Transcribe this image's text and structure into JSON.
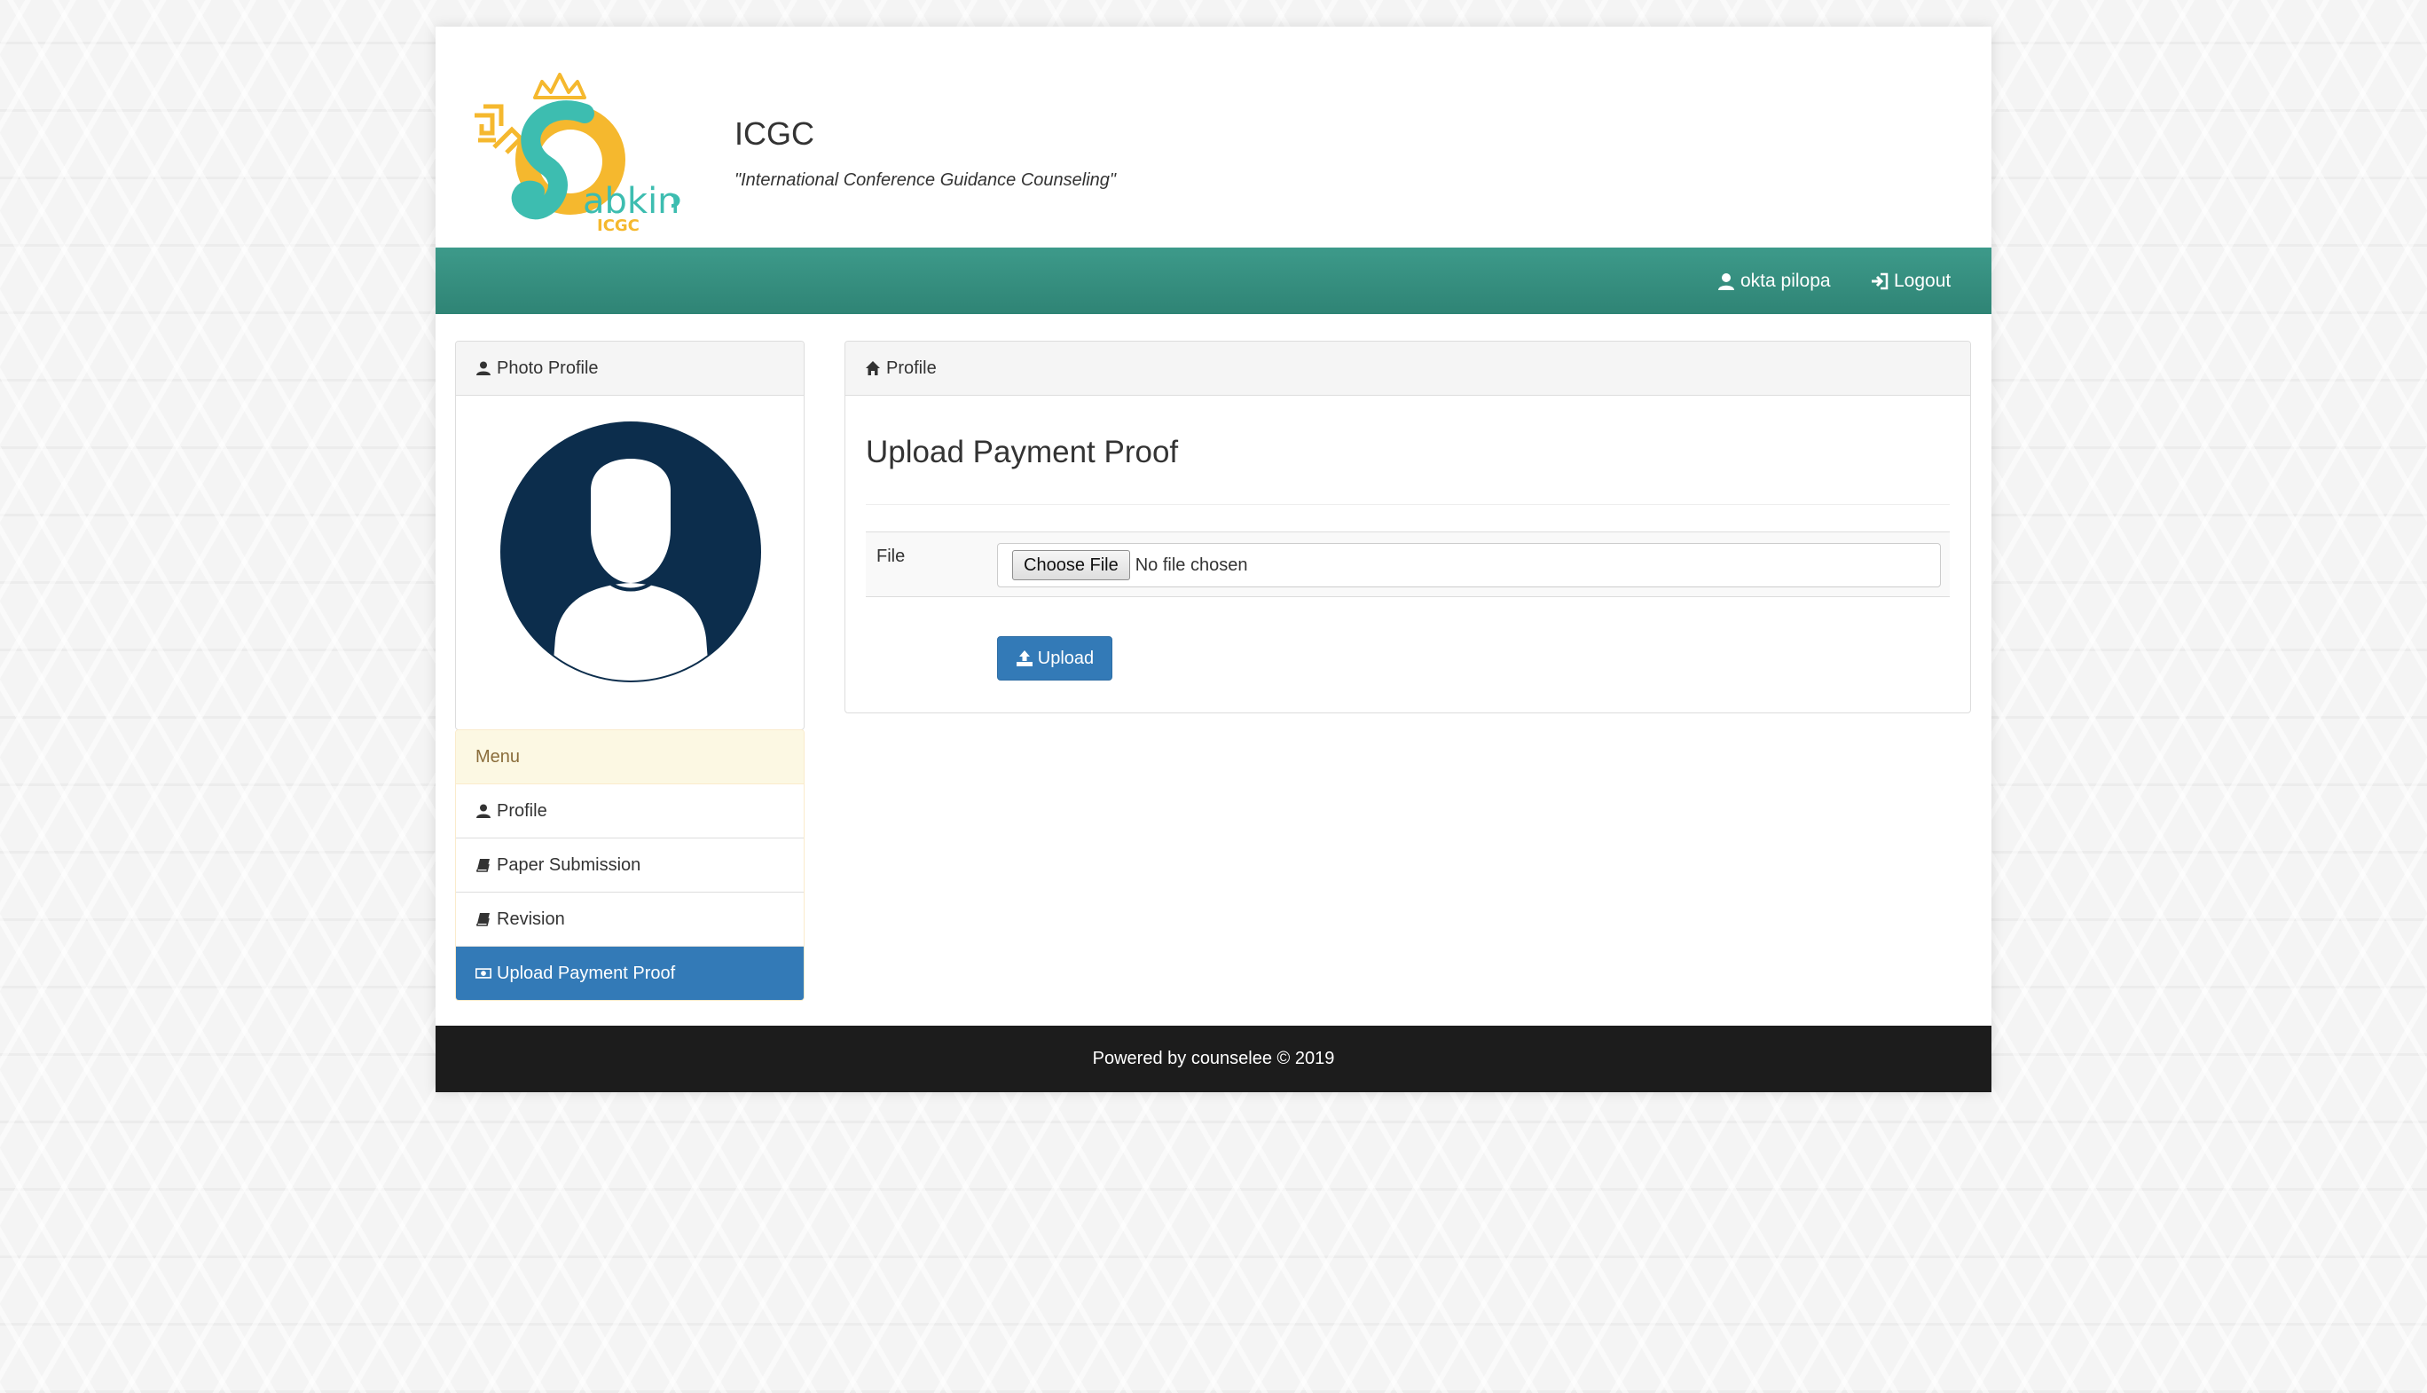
{
  "header": {
    "title": "ICGC",
    "tagline": "\"International Conference Guidance Counseling\"",
    "logo": {
      "icon": "sabkin-logo",
      "wordmark": "abkin",
      "subtext": "ICGC",
      "colors": {
        "yellow": "#f5b82e",
        "teal": "#3dbdb0"
      }
    }
  },
  "navbar": {
    "user_name": "okta pilopa",
    "logout_label": "Logout",
    "user_icon": "user-icon",
    "logout_icon": "sign-in-icon",
    "color": "#3a9484"
  },
  "photo_panel": {
    "title": "Photo Profile",
    "icon": "user-icon"
  },
  "menu": {
    "title": "Menu",
    "items": [
      {
        "label": "Profile",
        "icon": "user-icon"
      },
      {
        "label": "Paper Submission",
        "icon": "book-icon"
      },
      {
        "label": "Revision",
        "icon": "book-icon"
      },
      {
        "label": "Upload Payment Proof",
        "icon": "money-icon",
        "active": true
      }
    ]
  },
  "content": {
    "breadcrumb": "Profile",
    "breadcrumb_icon": "home-icon",
    "page_title": "Upload Payment Proof",
    "form": {
      "file_label": "File",
      "choose_file_label": "Choose File",
      "no_file_text": "No file chosen",
      "upload_label": "Upload",
      "upload_icon": "upload-icon"
    }
  },
  "footer": {
    "text": "Powered by counselee © 2019"
  },
  "colors": {
    "primary": "#337ab7",
    "nav_teal": "#3a9484",
    "avatar": "#0c2d4c",
    "warning_bg": "#fcf8e3",
    "footer_bg": "#1c1c1c"
  }
}
